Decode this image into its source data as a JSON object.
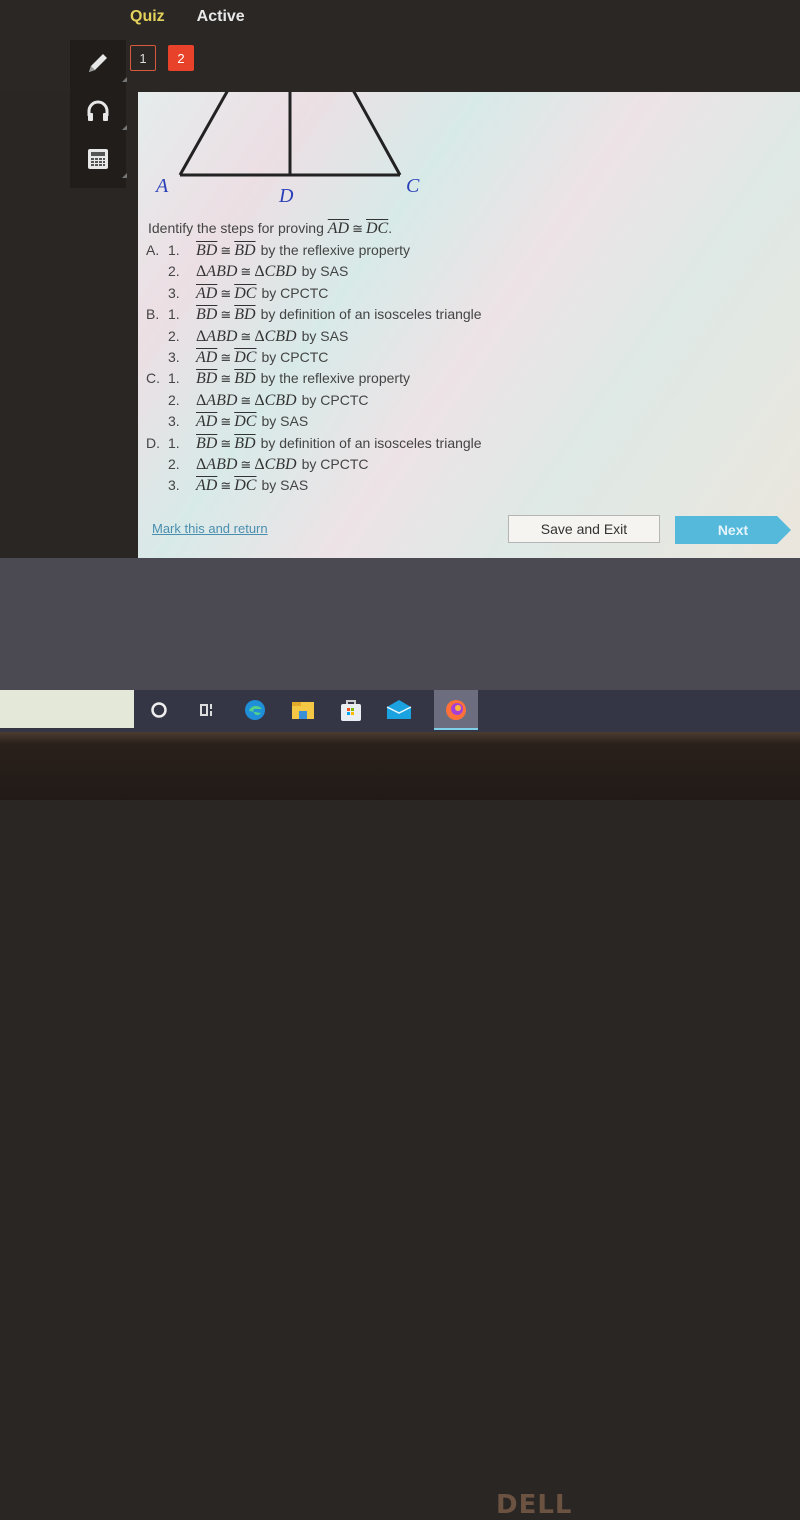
{
  "header": {
    "tabs": [
      {
        "label": "Quiz",
        "state": "selected"
      },
      {
        "label": "Active",
        "state": "status"
      }
    ],
    "question_numbers": [
      {
        "label": "1",
        "current": false
      },
      {
        "label": "2",
        "current": true
      }
    ]
  },
  "toolbar": {
    "tools": [
      {
        "name": "pencil-icon"
      },
      {
        "name": "headphones-icon"
      },
      {
        "name": "calculator-icon"
      }
    ]
  },
  "figure": {
    "points": [
      "A",
      "D",
      "C"
    ]
  },
  "question": {
    "prefix": "Identify the steps for proving ",
    "seg1": "AD",
    "cong": "≅",
    "seg2": "DC",
    "suffix": "."
  },
  "options": [
    {
      "letter": "A.",
      "steps": [
        {
          "num": "1.",
          "type": "seg",
          "left": "BD",
          "right": "BD",
          "reason": "by the reflexive property"
        },
        {
          "num": "2.",
          "type": "tri",
          "left": "ABD",
          "right": "CBD",
          "reason": "by SAS"
        },
        {
          "num": "3.",
          "type": "seg",
          "left": "AD",
          "right": "DC",
          "reason": "by CPCTC"
        }
      ]
    },
    {
      "letter": "B.",
      "steps": [
        {
          "num": "1.",
          "type": "seg",
          "left": "BD",
          "right": "BD",
          "reason": "by definition of an isosceles triangle"
        },
        {
          "num": "2.",
          "type": "tri",
          "left": "ABD",
          "right": "CBD",
          "reason": "by SAS"
        },
        {
          "num": "3.",
          "type": "seg",
          "left": "AD",
          "right": "DC",
          "reason": "by CPCTC"
        }
      ]
    },
    {
      "letter": "C.",
      "steps": [
        {
          "num": "1.",
          "type": "seg",
          "left": "BD",
          "right": "BD",
          "reason": "by the reflexive property"
        },
        {
          "num": "2.",
          "type": "tri",
          "left": "ABD",
          "right": "CBD",
          "reason": "by CPCTC"
        },
        {
          "num": "3.",
          "type": "seg",
          "left": "AD",
          "right": "DC",
          "reason": "by SAS"
        }
      ]
    },
    {
      "letter": "D.",
      "steps": [
        {
          "num": "1.",
          "type": "seg",
          "left": "BD",
          "right": "BD",
          "reason": "by definition of an isosceles triangle"
        },
        {
          "num": "2.",
          "type": "tri",
          "left": "ABD",
          "right": "CBD",
          "reason": "by CPCTC"
        },
        {
          "num": "3.",
          "type": "seg",
          "left": "AD",
          "right": "DC",
          "reason": "by SAS"
        }
      ]
    }
  ],
  "footer": {
    "mark_link": "Mark this and return",
    "save_button": "Save and Exit",
    "next_button": "Next"
  },
  "taskbar": {
    "icons": [
      "cortana-icon",
      "task-view-icon",
      "edge-icon",
      "file-explorer-icon",
      "store-icon",
      "mail-icon",
      "firefox-icon"
    ]
  },
  "bezel": {
    "brand": "DELL"
  },
  "colors": {
    "quiz_tab": "#e3d15b",
    "current_question": "#e8432a",
    "next_button": "#55b9dc",
    "link": "#4a8fb0",
    "point_label": "#2b3fb8"
  }
}
